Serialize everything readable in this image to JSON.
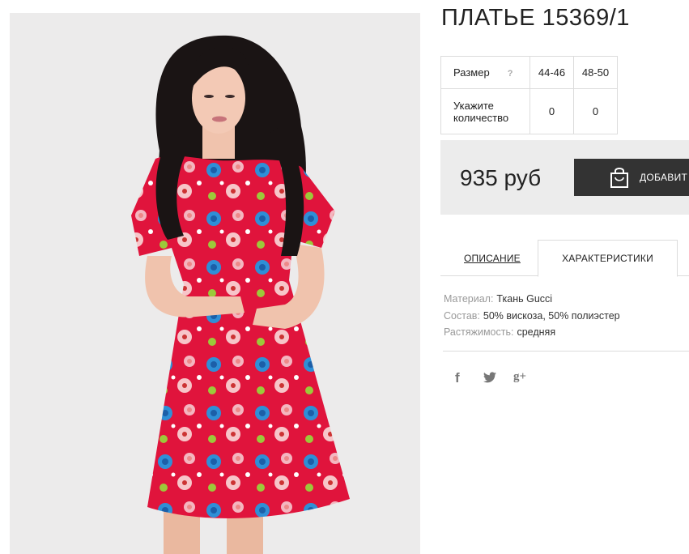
{
  "product": {
    "title": "ПЛАТЬЕ 15369/1",
    "image_icon": "dress-photo"
  },
  "sizes": {
    "label": "Размер",
    "help": "?",
    "options": [
      "44-46",
      "48-50"
    ],
    "qty_label": "Укажите количество",
    "quantities": [
      "0",
      "0"
    ]
  },
  "purchase": {
    "price": "935 руб",
    "add_button_label": "ДОБАВИТ",
    "add_button_icon": "shopping-bag-icon"
  },
  "tabs": [
    {
      "label": "ОПИСАНИЕ",
      "active": false
    },
    {
      "label": "ХАРАКТЕРИСТИКИ",
      "active": true
    }
  ],
  "characteristics": [
    {
      "key": "Материал:",
      "value": "Ткань Gucci"
    },
    {
      "key": "Состав:",
      "value": "50% вискоза, 50% полиэстер"
    },
    {
      "key": "Растяжимость:",
      "value": "средняя"
    }
  ],
  "social": {
    "facebook": "f",
    "twitter": "twitter-icon",
    "google_plus": "g+"
  },
  "colors": {
    "dress_red": "#e0143c",
    "button_dark": "#333333",
    "price_bg": "#ececec",
    "photo_bg": "#ecebeb"
  }
}
